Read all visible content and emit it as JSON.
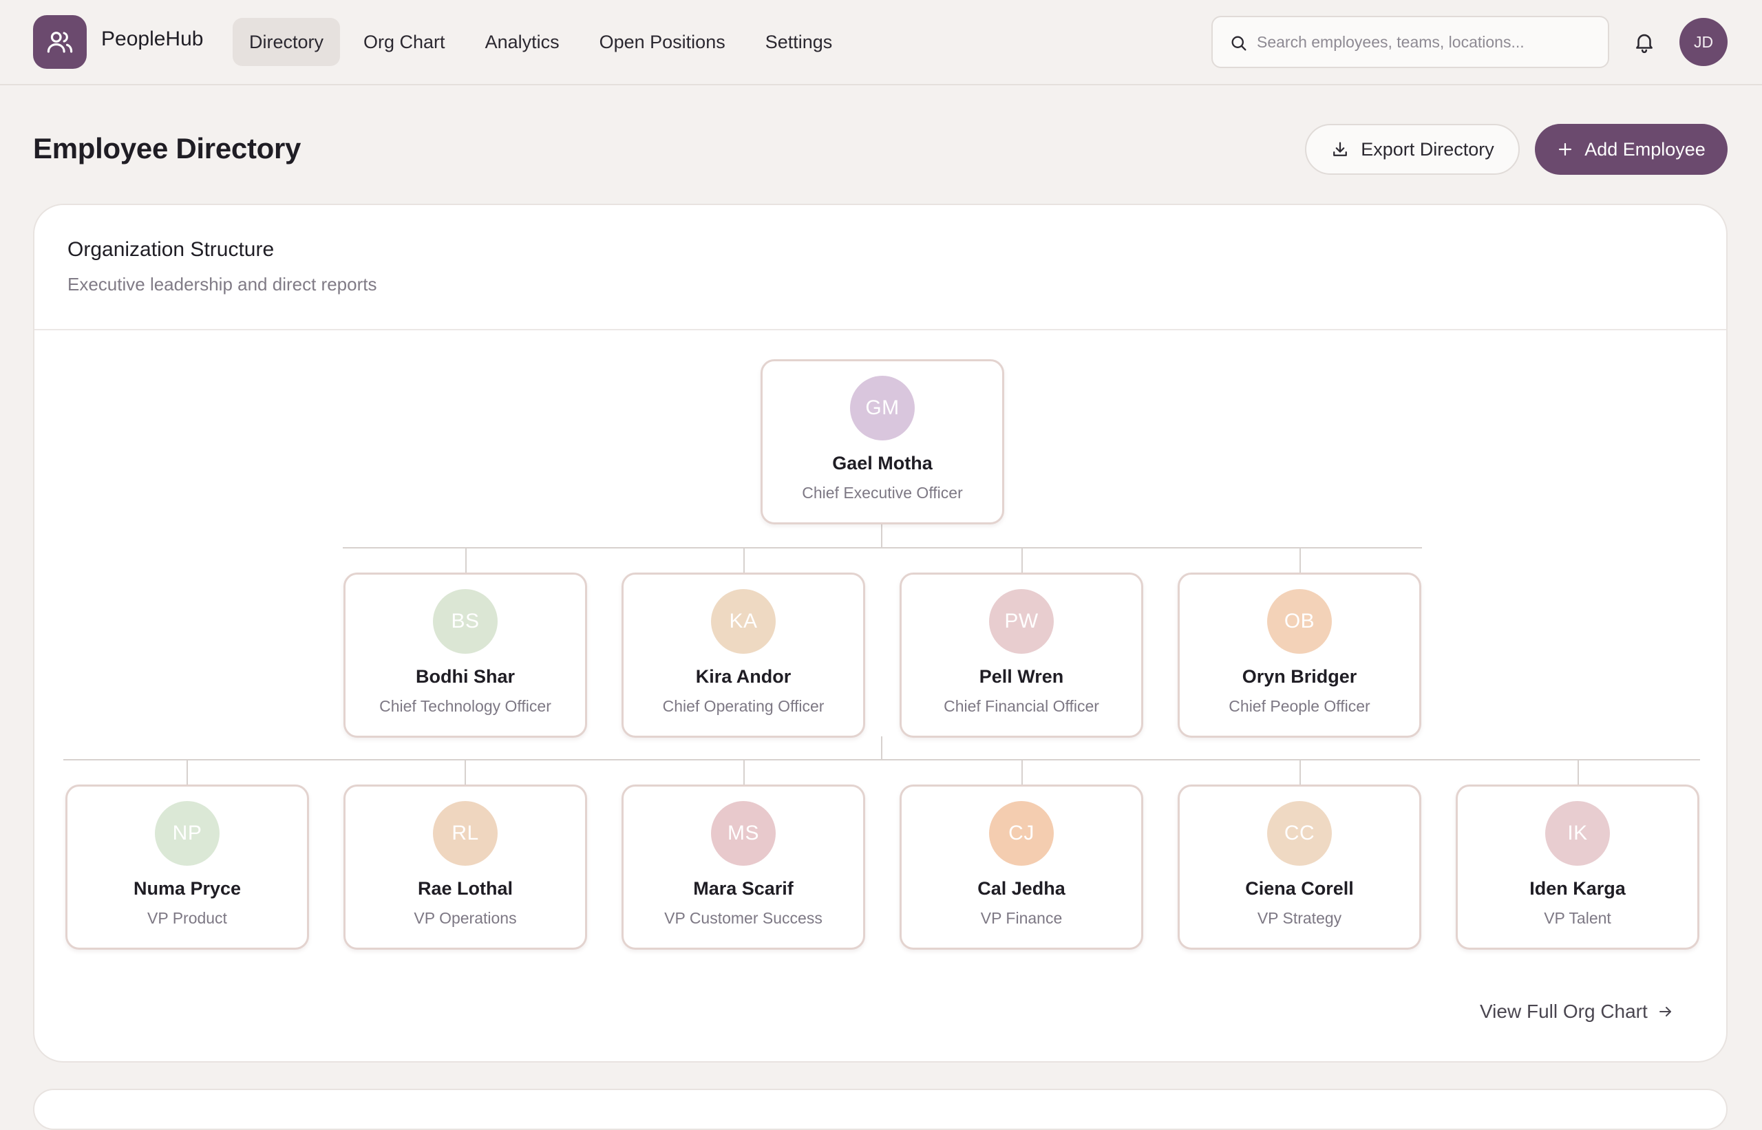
{
  "app": {
    "name": "PeopleHub"
  },
  "nav": {
    "items": [
      {
        "label": "Directory",
        "active": true
      },
      {
        "label": "Org Chart"
      },
      {
        "label": "Analytics"
      },
      {
        "label": "Open Positions"
      },
      {
        "label": "Settings"
      }
    ]
  },
  "search": {
    "placeholder": "Search employees, teams, locations..."
  },
  "user": {
    "initials": "JD"
  },
  "page": {
    "title": "Employee Directory",
    "export_label": "Export Directory",
    "add_label": "Add Employee"
  },
  "org": {
    "title": "Organization Structure",
    "subtitle": "Executive leadership and direct reports",
    "view_full_label": "View Full Org Chart",
    "ceo": {
      "initials": "GM",
      "name": "Gael Motha",
      "role": "Chief Executive Officer",
      "color": "#d9c6dd"
    },
    "executives": [
      {
        "initials": "BS",
        "name": "Bodhi Shar",
        "role": "Chief Technology Officer",
        "color": "#dbe6d4"
      },
      {
        "initials": "KA",
        "name": "Kira Andor",
        "role": "Chief Operating Officer",
        "color": "#eed9c2"
      },
      {
        "initials": "PW",
        "name": "Pell Wren",
        "role": "Chief Financial Officer",
        "color": "#e8cdcf"
      },
      {
        "initials": "OB",
        "name": "Oryn Bridger",
        "role": "Chief People Officer",
        "color": "#f3d2b8"
      }
    ],
    "vps": [
      {
        "initials": "NP",
        "name": "Numa Pryce",
        "role": "VP Product",
        "color": "#dbe8d6"
      },
      {
        "initials": "RL",
        "name": "Rae Lothal",
        "role": "VP Operations",
        "color": "#efd6bf"
      },
      {
        "initials": "MS",
        "name": "Mara Scarif",
        "role": "VP Customer Success",
        "color": "#e8c9cc"
      },
      {
        "initials": "CJ",
        "name": "Cal Jedha",
        "role": "VP Finance",
        "color": "#f4cdb0"
      },
      {
        "initials": "CC",
        "name": "Ciena Corell",
        "role": "VP Strategy",
        "color": "#efd9c3"
      },
      {
        "initials": "IK",
        "name": "Iden Karga",
        "role": "VP Talent",
        "color": "#e8cdd0"
      }
    ]
  },
  "colors": {
    "accent": "#6b4a6e",
    "node_border": "#e3d3cf",
    "connector": "#d7d1ce"
  }
}
